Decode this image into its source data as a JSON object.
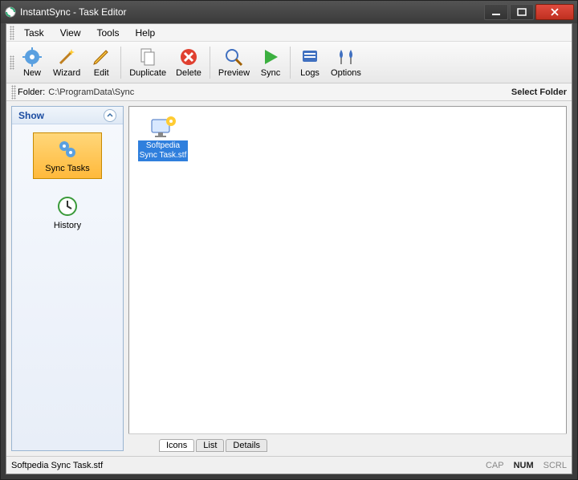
{
  "window": {
    "title": "InstantSync - Task Editor"
  },
  "menu": {
    "task": "Task",
    "view": "View",
    "tools": "Tools",
    "help": "Help"
  },
  "toolbar": {
    "new": "New",
    "wizard": "Wizard",
    "edit": "Edit",
    "duplicate": "Duplicate",
    "delete": "Delete",
    "preview": "Preview",
    "sync": "Sync",
    "logs": "Logs",
    "options": "Options"
  },
  "folderbar": {
    "label": "Folder:",
    "path": "C:\\ProgramData\\Sync",
    "select": "Select Folder"
  },
  "sidebar": {
    "header": "Show",
    "sync_tasks": "Sync Tasks",
    "history": "History"
  },
  "files": {
    "item0_line1": "Softpedia",
    "item0_line2": "Sync Task.stf"
  },
  "tabs": {
    "icons": "Icons",
    "list": "List",
    "details": "Details"
  },
  "status": {
    "left": "Softpedia Sync Task.stf",
    "cap": "CAP",
    "num": "NUM",
    "scrl": "SCRL"
  }
}
